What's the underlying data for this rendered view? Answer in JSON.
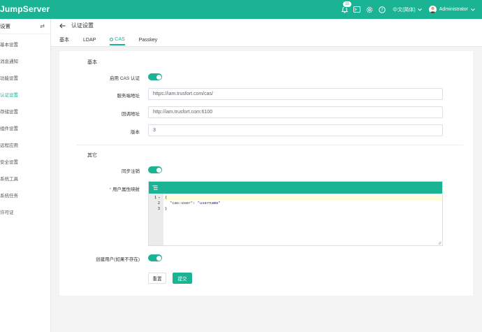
{
  "brand": "JumpServer",
  "topbar": {
    "notification_count": "15",
    "language": "中文(简体)",
    "username": "Administrator"
  },
  "sidebar": {
    "title": "设置",
    "items": [
      {
        "label": "基本设置"
      },
      {
        "label": "消息通知"
      },
      {
        "label": "功能设置"
      },
      {
        "label": "认证设置"
      },
      {
        "label": "存储设置"
      },
      {
        "label": "组件设置"
      },
      {
        "label": "远程应用"
      },
      {
        "label": "安全设置"
      },
      {
        "label": "系统工具"
      },
      {
        "label": "系统任务"
      },
      {
        "label": "许可证"
      }
    ]
  },
  "page": {
    "title": "认证设置",
    "tabs": [
      "基本",
      "LDAP",
      "CAS",
      "Passkey"
    ]
  },
  "form": {
    "section_basic": "基本",
    "enable_cas_label": "启用 CAS 认证",
    "server_url_label": "服务端地址",
    "server_url_value": "https://iam.trusfort.com/cas/",
    "callback_label": "回调地址",
    "callback_value": "http://iam.trusfort.com:6100",
    "version_label": "版本",
    "version_value": "3",
    "section_other": "其它",
    "sync_logout_label": "同步注销",
    "attr_map_label": "用户属性映射",
    "attr_map_required": "*",
    "create_user_label": "创建用户(如果不存在)",
    "reset_button": "重置",
    "submit_button": "提交"
  },
  "editor": {
    "line_numbers": [
      "1",
      "2",
      "3"
    ],
    "line1": "{",
    "line2_key": "\"cas:user\"",
    "line2_sep": ": ",
    "line2_value": "\"username\"",
    "line3": "}"
  }
}
